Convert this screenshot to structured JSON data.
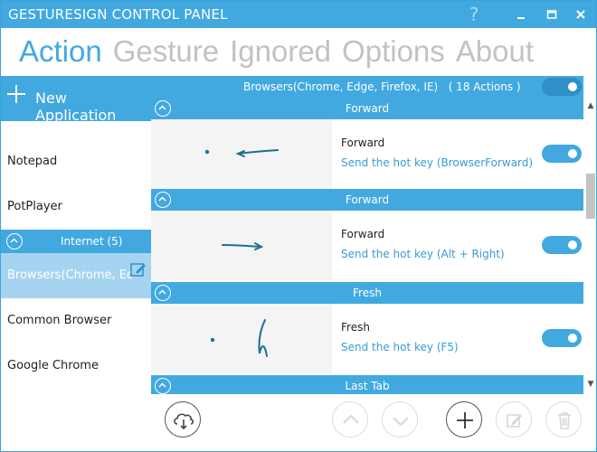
{
  "window": {
    "title": "GESTURESIGN CONTROL PANEL",
    "help_label": "?"
  },
  "tabs": [
    {
      "label": "Action",
      "active": true
    },
    {
      "label": "Gesture",
      "active": false
    },
    {
      "label": "Ignored",
      "active": false
    },
    {
      "label": "Options",
      "active": false
    },
    {
      "label": "About",
      "active": false
    }
  ],
  "sidebar": {
    "new_application_label": "New Application",
    "items_top": [
      {
        "label": "Notepad"
      },
      {
        "label": "PotPlayer"
      }
    ],
    "group": {
      "label": "Internet (5)"
    },
    "items_group": [
      {
        "label": "Browsers(Chrome, Edge, Firefox, IE)",
        "selected": true
      },
      {
        "label": "Common Browser",
        "selected": false
      },
      {
        "label": "Google Chrome",
        "selected": false
      }
    ]
  },
  "main": {
    "application": {
      "name": "Browsers(Chrome, Edge, Firefox, IE)",
      "action_count": "( 18 Actions )",
      "enabled": true
    },
    "sections": [
      {
        "header": "Forward",
        "action": {
          "name": "Forward",
          "description": "Send the hot key (BrowserForward)",
          "enabled": true,
          "gesture": "dot-then-left-stroke"
        }
      },
      {
        "header": "Forward",
        "action": {
          "name": "Forward",
          "description": "Send the hot key (Alt + Right)",
          "enabled": true,
          "gesture": "right-stroke"
        }
      },
      {
        "header": "Fresh",
        "action": {
          "name": "Fresh",
          "description": "Send the hot key (F5)",
          "enabled": true,
          "gesture": "dot-then-down-up-stroke"
        }
      },
      {
        "header": "Last Tab"
      }
    ]
  },
  "toolbar": {
    "buttons": [
      {
        "name": "download-cloud-icon",
        "disabled": false
      },
      {
        "name": "move-up-icon",
        "disabled": true
      },
      {
        "name": "move-down-icon",
        "disabled": true
      },
      {
        "name": "add-icon",
        "disabled": false
      },
      {
        "name": "edit-icon",
        "disabled": true
      },
      {
        "name": "delete-icon",
        "disabled": true
      }
    ]
  },
  "colors": {
    "accent": "#41a9e0",
    "selected_item": "#a6d4f0",
    "gesture_ink": "#1f6f93",
    "link_text": "#3a9bd5"
  }
}
